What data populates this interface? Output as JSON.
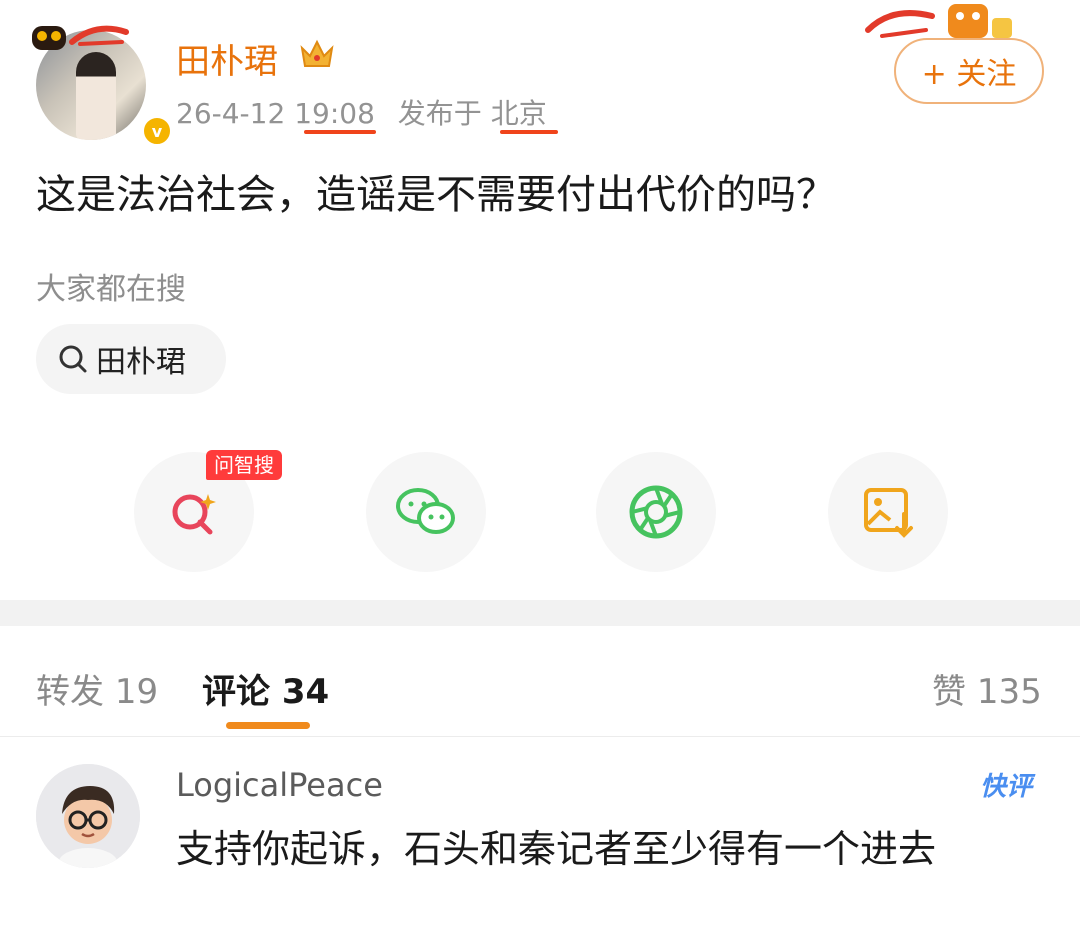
{
  "post": {
    "username": "田朴珺",
    "timestamp_date": "26-4-12",
    "timestamp_time": "19:08",
    "published_label": "发布于",
    "location": "北京",
    "follow_label": "+ 关注",
    "text": "这是法治社会，造谣是不需要付出代价的吗？"
  },
  "search": {
    "section_title": "大家都在搜",
    "chip_label": "田朴珺"
  },
  "share": {
    "wenzhisou_tag": "问智搜",
    "icons": [
      "search-sparkle-icon",
      "wechat-icon",
      "moments-icon",
      "save-image-icon"
    ],
    "colors": {
      "search": "#e8455b",
      "wechat": "#46c35f",
      "moments": "#46c35f",
      "save": "#f0a51c"
    }
  },
  "stats": {
    "repost_label": "转发",
    "repost_count": "19",
    "comment_label": "评论",
    "comment_count": "34",
    "like_label": "赞",
    "like_count": "135"
  },
  "comment": {
    "author": "LogicalPeace",
    "text": "支持你起诉，石头和秦记者至少得有一个进去",
    "badge": "快评"
  },
  "colors": {
    "accent": "#e8730c",
    "tab_underline": "#f08a1c",
    "red_underline": "#f0441b"
  }
}
